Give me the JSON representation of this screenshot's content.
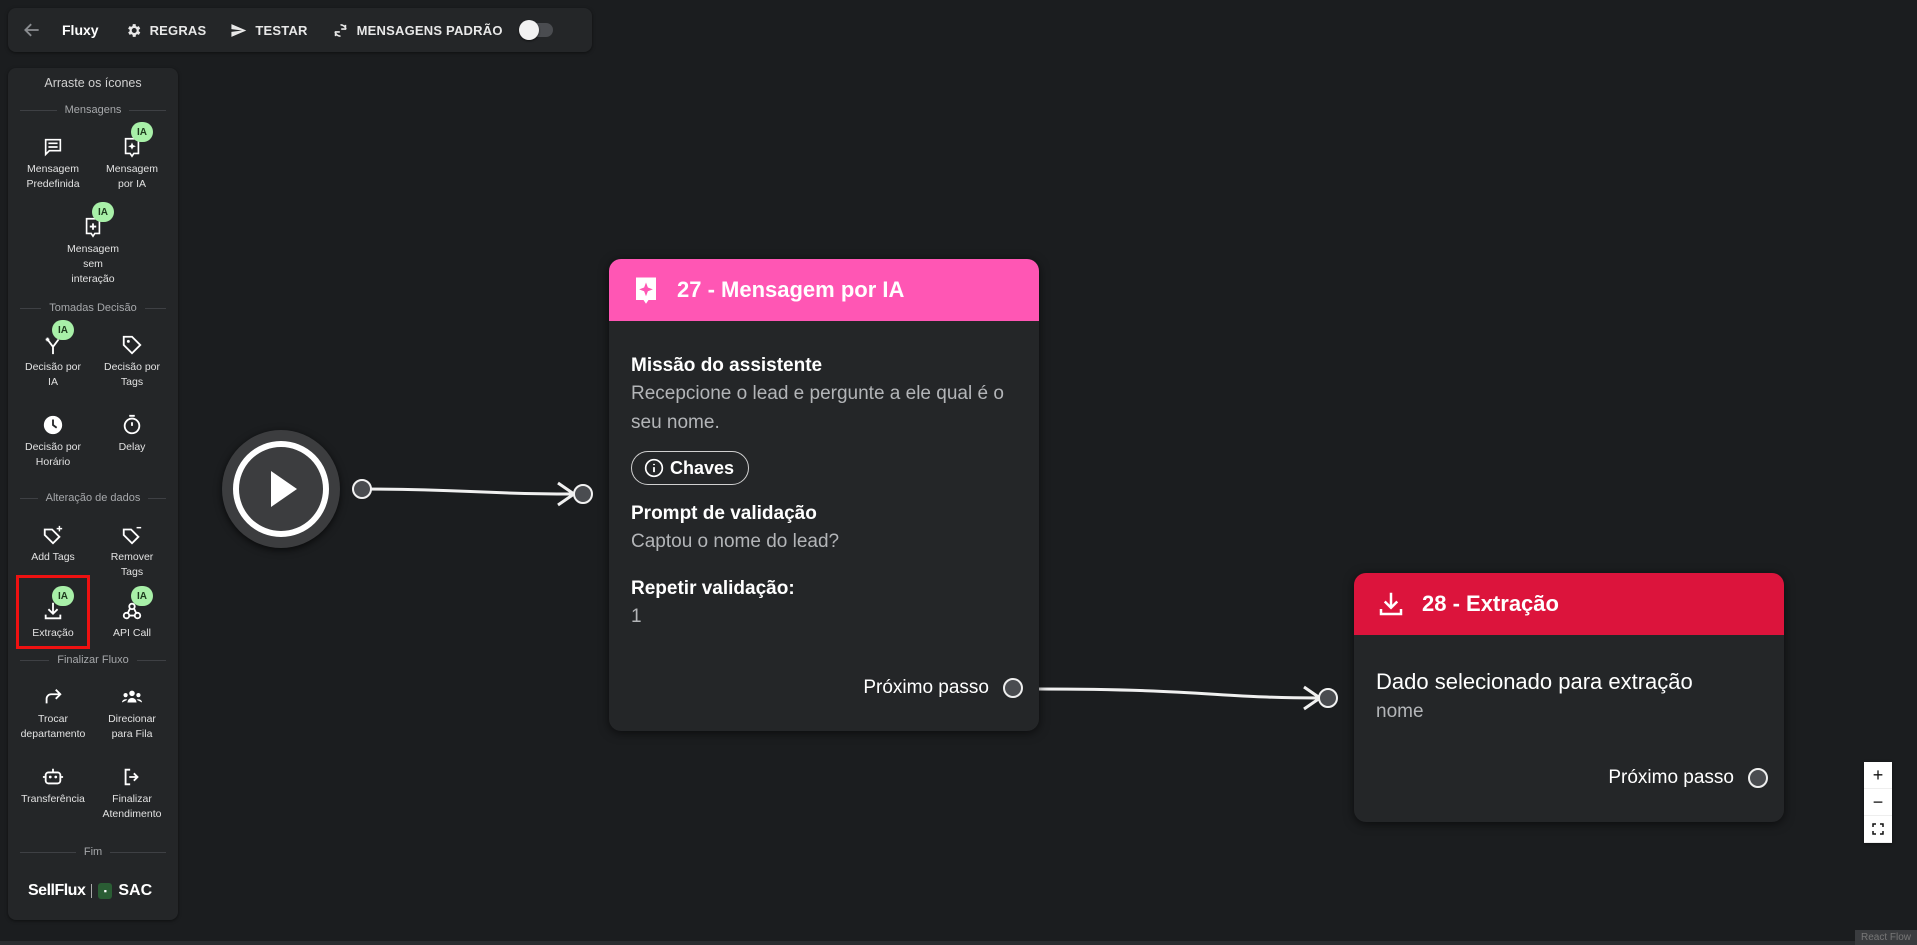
{
  "toolbar": {
    "title": "Fluxy",
    "rules_label": "REGRAS",
    "test_label": "TESTAR",
    "default_messages_label": "MENSAGENS PADRÃO"
  },
  "palette": {
    "header": "Arraste os ícones",
    "sections": {
      "messages": "Mensagens",
      "decisions": "Tomadas Decisão",
      "data_change": "Alteração de dados",
      "finish": "Finalizar Fluxo",
      "end": "Fim"
    },
    "ia_badge": "IA",
    "items": {
      "predefined_message": "Mensagem Predefinida",
      "ai_message": "Mensagem por IA",
      "no_interaction_message": "Mensagem sem interação",
      "ai_decision": "Decisão por IA",
      "tag_decision": "Decisão por Tags",
      "time_decision": "Decisão por Horário",
      "delay": "Delay",
      "add_tags": "Add Tags",
      "remove_tags": "Remover Tags",
      "extraction": "Extração",
      "api_call": "API Call",
      "change_department": "Trocar departamento",
      "direct_queue": "Direcionar para Fila",
      "transfer": "Transferência",
      "finish_service": "Finalizar Atendimento"
    },
    "brand": {
      "sellflux": "SellFlux",
      "sac": "SAC"
    }
  },
  "nodes": {
    "ai_message": {
      "title": "27 - Mensagem por IA",
      "header_color": "#ff56b4",
      "mission_label": "Missão do assistente",
      "mission_value": "Recepcione o lead e pergunte a ele qual é o seu nome.",
      "keys_chip": "Chaves",
      "prompt_label": "Prompt de validação",
      "prompt_value": "Captou o nome do lead?",
      "repeat_label": "Repetir validação:",
      "repeat_value": "1",
      "next_label": "Próximo passo"
    },
    "extraction": {
      "title": "28 - Extração",
      "header_color": "#dc143c",
      "field_label": "Dado selecionado para extração",
      "field_value": "nome",
      "next_label": "Próximo passo"
    }
  },
  "zoom": {
    "in": "+",
    "out": "−"
  },
  "attribution": "React Flow"
}
